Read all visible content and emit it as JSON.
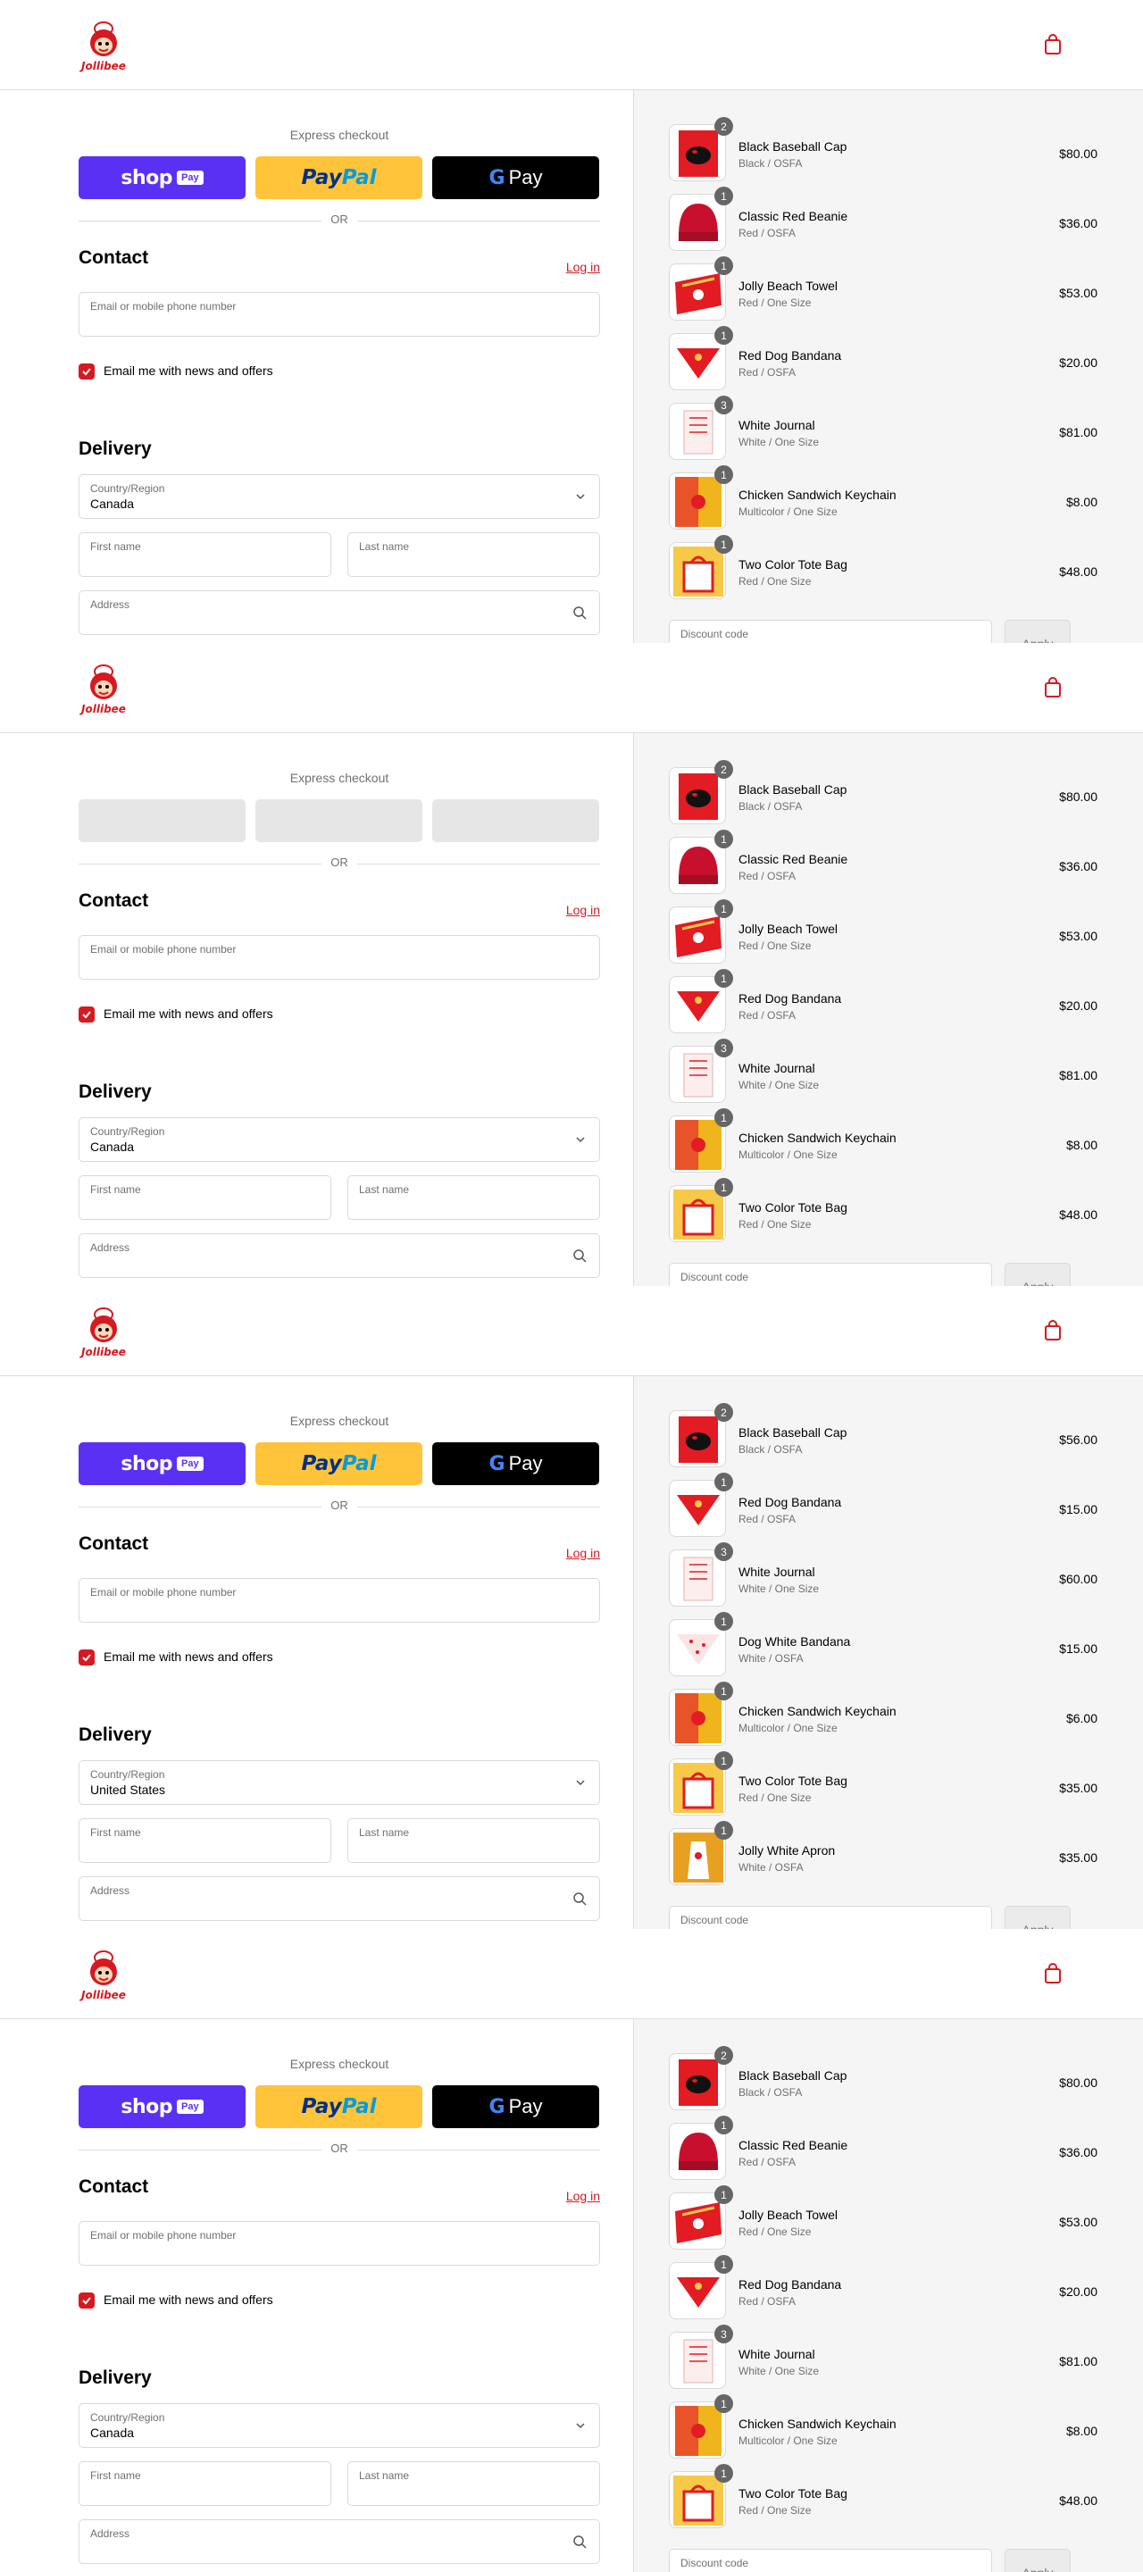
{
  "colors": {
    "brand": "#d71920",
    "shop_pay": "#5a31f4",
    "paypal": "#ffc439",
    "gpay": "#000000",
    "sidebar_bg": "#f5f5f5"
  },
  "common": {
    "logo_text": "Jollibee",
    "express_title": "Express checkout",
    "shop_word": "shop",
    "shop_pay_badge": "Pay",
    "paypal_a": "Pay",
    "paypal_b": "Pal",
    "gpay_g": "G",
    "gpay_pay": "Pay",
    "or": "OR",
    "contact_heading": "Contact",
    "login": "Log in",
    "email_placeholder": "Email or mobile phone number",
    "news_label": "Email me with news and offers",
    "delivery_heading": "Delivery",
    "country_label": "Country/Region",
    "first_name": "First name",
    "last_name": "Last name",
    "address": "Address",
    "discount_placeholder": "Discount code",
    "apply": "Apply"
  },
  "frames": [
    {
      "express_loaded": true,
      "country": "Canada",
      "items": [
        {
          "name": "Black Baseball Cap",
          "variant": "Black / OSFA",
          "price": "$80.00",
          "qty": "2",
          "thumb": "cap"
        },
        {
          "name": "Classic Red Beanie",
          "variant": "Red / OSFA",
          "price": "$36.00",
          "qty": "1",
          "thumb": "beanie"
        },
        {
          "name": "Jolly Beach Towel",
          "variant": "Red / One Size",
          "price": "$53.00",
          "qty": "1",
          "thumb": "towel"
        },
        {
          "name": "Red Dog Bandana",
          "variant": "Red / OSFA",
          "price": "$20.00",
          "qty": "1",
          "thumb": "bandana-red"
        },
        {
          "name": "White Journal",
          "variant": "White / One Size",
          "price": "$81.00",
          "qty": "3",
          "thumb": "journal"
        },
        {
          "name": "Chicken Sandwich Keychain",
          "variant": "Multicolor / One Size",
          "price": "$8.00",
          "qty": "1",
          "thumb": "keychain"
        },
        {
          "name": "Two Color Tote Bag",
          "variant": "Red / One Size",
          "price": "$48.00",
          "qty": "1",
          "thumb": "tote"
        }
      ]
    },
    {
      "express_loaded": false,
      "country": "Canada",
      "items": [
        {
          "name": "Black Baseball Cap",
          "variant": "Black / OSFA",
          "price": "$80.00",
          "qty": "2",
          "thumb": "cap"
        },
        {
          "name": "Classic Red Beanie",
          "variant": "Red / OSFA",
          "price": "$36.00",
          "qty": "1",
          "thumb": "beanie"
        },
        {
          "name": "Jolly Beach Towel",
          "variant": "Red / One Size",
          "price": "$53.00",
          "qty": "1",
          "thumb": "towel"
        },
        {
          "name": "Red Dog Bandana",
          "variant": "Red / OSFA",
          "price": "$20.00",
          "qty": "1",
          "thumb": "bandana-red"
        },
        {
          "name": "White Journal",
          "variant": "White / One Size",
          "price": "$81.00",
          "qty": "3",
          "thumb": "journal"
        },
        {
          "name": "Chicken Sandwich Keychain",
          "variant": "Multicolor / One Size",
          "price": "$8.00",
          "qty": "1",
          "thumb": "keychain"
        },
        {
          "name": "Two Color Tote Bag",
          "variant": "Red / One Size",
          "price": "$48.00",
          "qty": "1",
          "thumb": "tote"
        }
      ]
    },
    {
      "express_loaded": true,
      "country": "United States",
      "items": [
        {
          "name": "Black Baseball Cap",
          "variant": "Black / OSFA",
          "price": "$56.00",
          "qty": "2",
          "thumb": "cap"
        },
        {
          "name": "Red Dog Bandana",
          "variant": "Red / OSFA",
          "price": "$15.00",
          "qty": "1",
          "thumb": "bandana-red"
        },
        {
          "name": "White Journal",
          "variant": "White / One Size",
          "price": "$60.00",
          "qty": "3",
          "thumb": "journal"
        },
        {
          "name": "Dog White Bandana",
          "variant": "White / OSFA",
          "price": "$15.00",
          "qty": "1",
          "thumb": "bandana-white"
        },
        {
          "name": "Chicken Sandwich Keychain",
          "variant": "Multicolor / One Size",
          "price": "$6.00",
          "qty": "1",
          "thumb": "keychain"
        },
        {
          "name": "Two Color Tote Bag",
          "variant": "Red / One Size",
          "price": "$35.00",
          "qty": "1",
          "thumb": "tote"
        },
        {
          "name": "Jolly White Apron",
          "variant": "White / OSFA",
          "price": "$35.00",
          "qty": "1",
          "thumb": "apron"
        }
      ]
    },
    {
      "express_loaded": true,
      "country": "Canada",
      "items": [
        {
          "name": "Black Baseball Cap",
          "variant": "Black / OSFA",
          "price": "$80.00",
          "qty": "2",
          "thumb": "cap"
        },
        {
          "name": "Classic Red Beanie",
          "variant": "Red / OSFA",
          "price": "$36.00",
          "qty": "1",
          "thumb": "beanie"
        },
        {
          "name": "Jolly Beach Towel",
          "variant": "Red / One Size",
          "price": "$53.00",
          "qty": "1",
          "thumb": "towel"
        },
        {
          "name": "Red Dog Bandana",
          "variant": "Red / OSFA",
          "price": "$20.00",
          "qty": "1",
          "thumb": "bandana-red"
        },
        {
          "name": "White Journal",
          "variant": "White / One Size",
          "price": "$81.00",
          "qty": "3",
          "thumb": "journal"
        },
        {
          "name": "Chicken Sandwich Keychain",
          "variant": "Multicolor / One Size",
          "price": "$8.00",
          "qty": "1",
          "thumb": "keychain"
        },
        {
          "name": "Two Color Tote Bag",
          "variant": "Red / One Size",
          "price": "$48.00",
          "qty": "1",
          "thumb": "tote"
        }
      ]
    }
  ]
}
